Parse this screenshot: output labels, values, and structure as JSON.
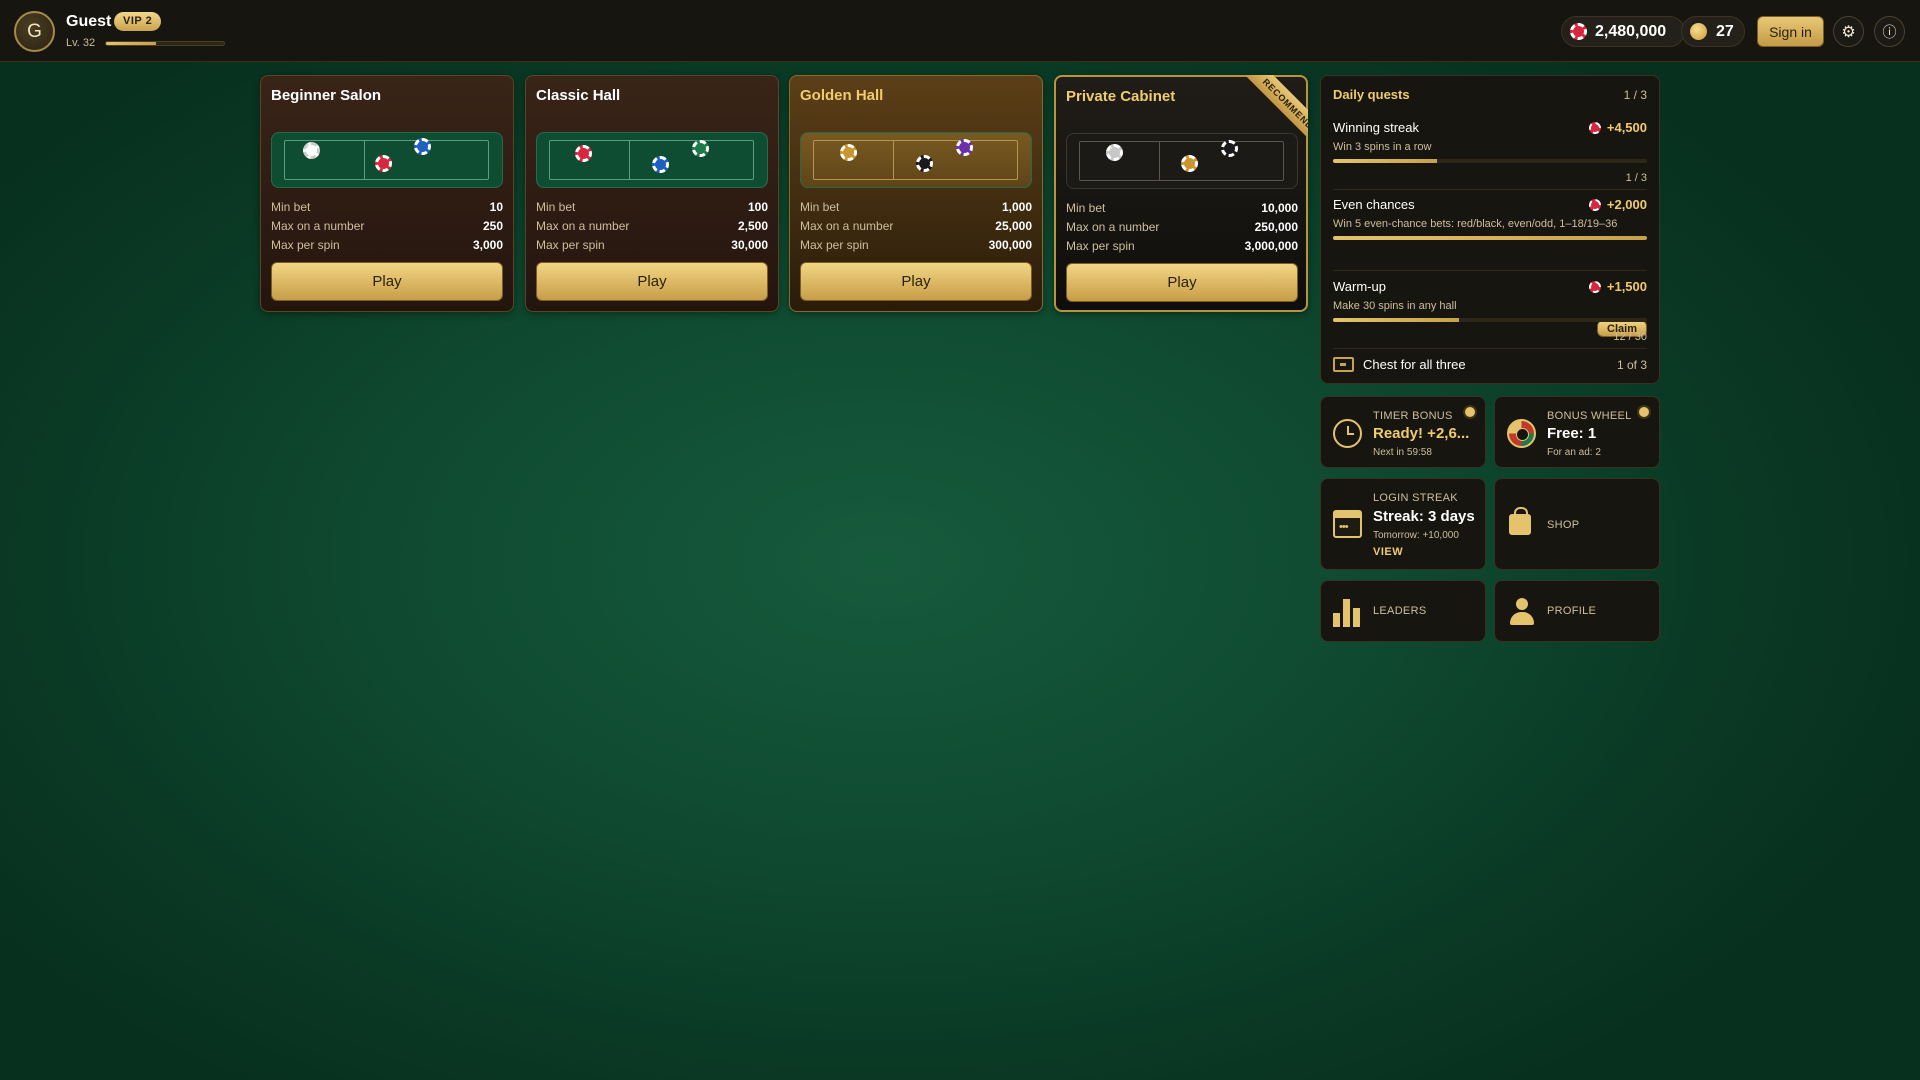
{
  "user": {
    "initial": "G",
    "name": "Guest",
    "vip": "VIP 2",
    "level": "Lv. 32",
    "xp_fraction": 0.42
  },
  "balance": {
    "chips": "2,480,000",
    "coins": "27"
  },
  "header": {
    "signin_label": "Sign in",
    "settings_icon": "gear-icon",
    "info_icon": "info-icon"
  },
  "halls": [
    {
      "title": "Beginner Salon",
      "min_bet_label": "Min bet",
      "min_bet": "10",
      "max_number_label": "Max on a number",
      "max_number": "250",
      "max_spin_label": "Max per spin",
      "max_spin": "3,000",
      "play_label": "Play",
      "chip_colors": [
        "#ffffff",
        "#d7263d",
        "#1f5fbf"
      ]
    },
    {
      "title": "Classic Hall",
      "min_bet_label": "Min bet",
      "min_bet": "100",
      "max_number_label": "Max on a number",
      "max_number": "2,500",
      "max_spin_label": "Max per spin",
      "max_spin": "30,000",
      "play_label": "Play",
      "chip_colors": [
        "#d7263d",
        "#1f5fbf",
        "#1e7a48"
      ]
    },
    {
      "title": "Golden Hall",
      "min_bet_label": "Min bet",
      "min_bet": "1,000",
      "max_number_label": "Max on a number",
      "max_number": "25,000",
      "max_spin_label": "Max per spin",
      "max_spin": "300,000",
      "play_label": "Play",
      "chip_colors": [
        "#c9952f",
        "#1a1a1a",
        "#6b2fa8"
      ]
    },
    {
      "title": "Private Cabinet",
      "ribbon": "RECOMMENDED",
      "min_bet_label": "Min bet",
      "min_bet": "10,000",
      "max_number_label": "Max on a number",
      "max_number": "250,000",
      "max_spin_label": "Max per spin",
      "max_spin": "3,000,000",
      "play_label": "Play",
      "chip_colors": [
        "#c8c8c8",
        "#c9952f",
        "#1a1a1a"
      ]
    }
  ],
  "quests": {
    "title": "Daily quests",
    "count": "1 / 3",
    "items": [
      {
        "title": "Winning streak",
        "reward": "+4,500",
        "desc": "Win 3 spins in a row",
        "progress": "1 / 3",
        "fraction": 0.33
      },
      {
        "title": "Even chances",
        "reward": "+2,000",
        "desc": "Win 5 even-chance bets: red/black, even/odd, 1–18/19–36",
        "fraction": 1.0,
        "claim_label": "Claim"
      },
      {
        "title": "Warm-up",
        "reward": "+1,500",
        "desc": "Make 30 spins in any hall",
        "progress": "12 / 30",
        "fraction": 0.4
      }
    ],
    "chest_label": "Chest for all three",
    "chest_count": "1 of 3"
  },
  "tiles": {
    "timer": {
      "label": "TIMER BONUS",
      "value": "Ready! +2,6...",
      "sub": "Next in 59:58"
    },
    "wheel": {
      "label": "BONUS WHEEL",
      "value": "Free: 1",
      "sub": "For an ad: 2"
    },
    "streak": {
      "label": "LOGIN STREAK",
      "value": "Streak: 3 days",
      "sub": "Tomorrow: +10,000",
      "link": "VIEW"
    },
    "shop": {
      "label": "SHOP"
    },
    "leaders": {
      "label": "LEADERS"
    },
    "profile": {
      "label": "PROFILE"
    }
  },
  "colors": {
    "gold": "#e5c36d",
    "felt": "#0f4d33",
    "chip_red": "#d7263d"
  }
}
